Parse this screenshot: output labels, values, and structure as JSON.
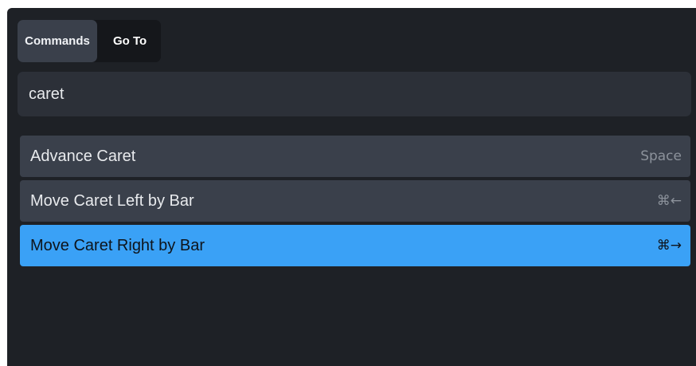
{
  "tabs": [
    {
      "label": "Commands",
      "active": true
    },
    {
      "label": "Go To",
      "active": false
    }
  ],
  "search": {
    "value": "caret",
    "placeholder": ""
  },
  "results": [
    {
      "label": "Advance Caret",
      "shortcut": "Space",
      "selected": false
    },
    {
      "label": "Move Caret Left by Bar",
      "shortcut": "⌘←",
      "selected": false
    },
    {
      "label": "Move Caret Right by Bar",
      "shortcut": "⌘→",
      "selected": true
    }
  ],
  "colors": {
    "panel_background": "#1e2126",
    "row_background": "#3a404b",
    "selected_row": "#3aa1f6"
  }
}
